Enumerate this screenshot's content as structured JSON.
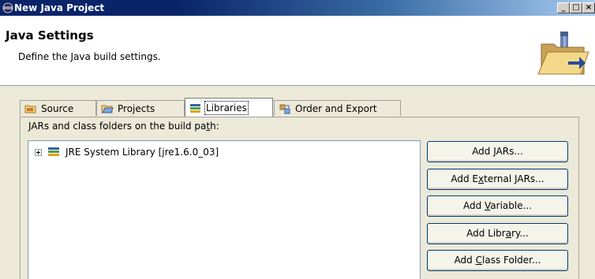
{
  "window": {
    "title": "New Java Project",
    "controls": [
      "_",
      "□",
      "×"
    ]
  },
  "header": {
    "title": "Java Settings",
    "description": "Define the Java build settings."
  },
  "tabs": [
    {
      "label": "Source",
      "icon": "source-folder-icon",
      "active": false
    },
    {
      "label": "Projects",
      "icon": "projects-icon",
      "active": false
    },
    {
      "label": "Libraries",
      "icon": "libraries-icon",
      "active": true
    },
    {
      "label": "Order and Export",
      "icon": "order-export-icon",
      "active": false
    }
  ],
  "libraries": {
    "label": {
      "pre": "JARs and class folders on the build pa",
      "mnemonic": "t",
      "post": "h:"
    },
    "tree_items": [
      {
        "label": "JRE System Library [jre1.6.0_03]",
        "expandable": true
      }
    ],
    "buttons": [
      {
        "pre": "Add ",
        "mnemonic": "J",
        "post": "ARs..."
      },
      {
        "pre": "Add E",
        "mnemonic": "x",
        "post": "ternal JARs..."
      },
      {
        "pre": "Add ",
        "mnemonic": "V",
        "post": "ariable..."
      },
      {
        "pre": "Add Libr",
        "mnemonic": "a",
        "post": "ry..."
      },
      {
        "pre": "Add ",
        "mnemonic": "C",
        "post": "lass Folder..."
      }
    ]
  },
  "colors": {
    "titlebar_start": "#0a246a",
    "titlebar_end": "#a6caf0",
    "dialog_bg": "#ece9d8"
  }
}
